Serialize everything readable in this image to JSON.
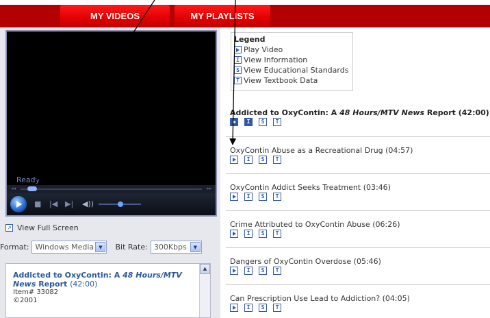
{
  "nav": {
    "my_videos": "MY VIDEOS",
    "my_playlists": "MY PLAYLISTS"
  },
  "player": {
    "status": "Ready"
  },
  "view_full_screen": "View Full Screen",
  "format": {
    "label": "Format:",
    "value": "Windows Media",
    "bitrate_label": "Bit Rate:",
    "bitrate_value": "300Kbps"
  },
  "info": {
    "title_prefix": "Addicted to OxyContin: A ",
    "title_italic": "48 Hours/MTV News",
    "title_suffix": " Report",
    "duration": "(42:00)",
    "item": "Item# 33082",
    "year": "©2001"
  },
  "legend": {
    "heading": "Legend",
    "items": [
      "Play Video",
      "View Information",
      "View Educational Standards",
      "View Textbook Data"
    ]
  },
  "main_video": {
    "prefix": "Addicted to OxyContin: A ",
    "italic": "48 Hours/MTV News",
    "suffix": " Report (42:00)"
  },
  "segments": [
    "OxyContin Abuse as a Recreational Drug (04:57)",
    "OxyContin Addict Seeks Treatment (03:46)",
    "Crime Attributed to OxyContin Abuse (06:26)",
    "Dangers of OxyContin Overdose (05:46)",
    "Can Prescription Use Lead to Addiction? (04:05)"
  ],
  "icon_letters": {
    "info": "I",
    "standards": "S",
    "textbook": "T"
  },
  "colors": {
    "nav_red": "#b30000",
    "link_blue": "#2b5a96",
    "icon_blue": "#2f5aa3"
  }
}
